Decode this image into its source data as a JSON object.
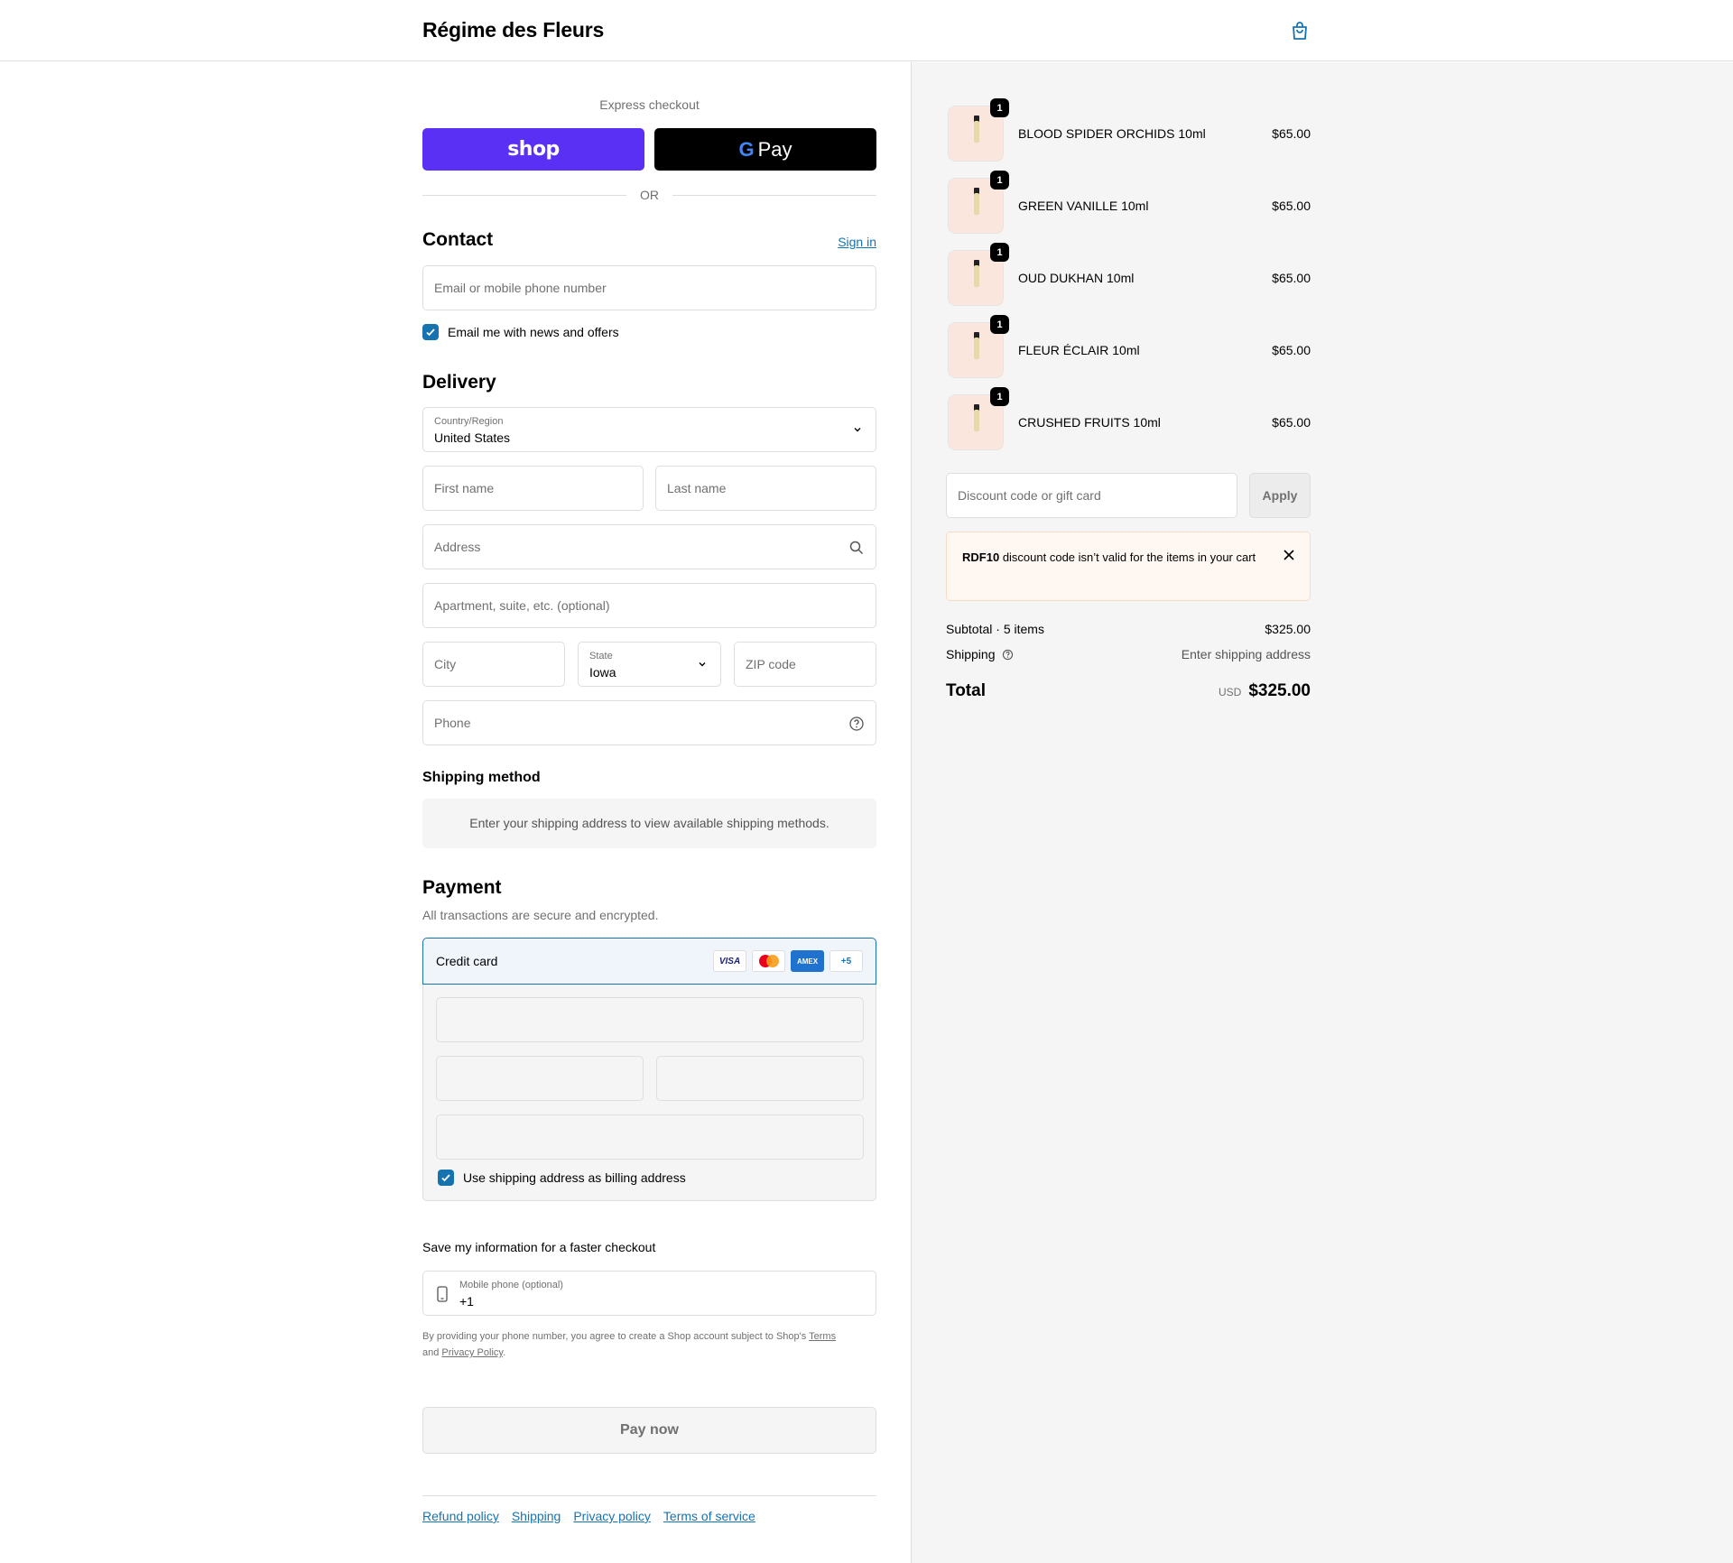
{
  "header": {
    "brand": "Régime des Fleurs"
  },
  "express": {
    "label": "Express checkout",
    "shop_label": "shop",
    "gpay_g": "G",
    "gpay_label": "Pay",
    "or_label": "OR"
  },
  "contact": {
    "heading": "Contact",
    "sign_in": "Sign in",
    "email_placeholder": "Email or mobile phone number",
    "newsletter_label": "Email me with news and offers",
    "newsletter_checked": true
  },
  "delivery": {
    "heading": "Delivery",
    "country_label": "Country/Region",
    "country_value": "United States",
    "first_name_placeholder": "First name",
    "last_name_placeholder": "Last name",
    "address_placeholder": "Address",
    "apartment_placeholder": "Apartment, suite, etc. (optional)",
    "city_placeholder": "City",
    "state_label": "State",
    "state_value": "Iowa",
    "zip_placeholder": "ZIP code",
    "phone_placeholder": "Phone"
  },
  "shipping_method": {
    "heading": "Shipping method",
    "message": "Enter your shipping address to view available shipping methods."
  },
  "payment": {
    "heading": "Payment",
    "subtitle": "All transactions are secure and encrypted.",
    "method_label": "Credit card",
    "cards": [
      "VISA",
      "MC",
      "AMEX"
    ],
    "more_cards": "+5",
    "billing_same_label": "Use shipping address as billing address",
    "billing_same_checked": true
  },
  "save_info": {
    "heading": "Save my information for a faster checkout",
    "mobile_label": "Mobile phone (optional)",
    "mobile_value": "+1",
    "legal_prefix": "By providing your phone number, you agree to create a Shop account subject to Shop's",
    "terms_link": "Terms",
    "legal_and": "and",
    "privacy_link": "Privacy Policy",
    "legal_suffix": "."
  },
  "pay_button": "Pay now",
  "footer": {
    "links": [
      "Refund policy",
      "Shipping",
      "Privacy policy",
      "Terms of service"
    ]
  },
  "summary": {
    "items": [
      {
        "name": "BLOOD SPIDER ORCHIDS 10ml",
        "price": "$65.00",
        "qty": "1"
      },
      {
        "name": "GREEN VANILLE 10ml",
        "price": "$65.00",
        "qty": "1"
      },
      {
        "name": "OUD DUKHAN 10ml",
        "price": "$65.00",
        "qty": "1"
      },
      {
        "name": "FLEUR ÉCLAIR 10ml",
        "price": "$65.00",
        "qty": "1"
      },
      {
        "name": "CRUSHED FRUITS 10ml",
        "price": "$65.00",
        "qty": "1"
      }
    ],
    "discount_placeholder": "Discount code or gift card",
    "apply_label": "Apply",
    "alert_code": "RDF10",
    "alert_message": "discount code isn’t valid for the items in your cart",
    "subtotal_label": "Subtotal · 5 items",
    "subtotal_value": "$325.00",
    "shipping_label": "Shipping",
    "shipping_value": "Enter shipping address",
    "total_label": "Total",
    "currency": "USD",
    "total_value": "$325.00"
  },
  "colors": {
    "accent": "#1773b0",
    "shop_purple": "#5a31f4",
    "alert_bg": "#fff8f2"
  }
}
